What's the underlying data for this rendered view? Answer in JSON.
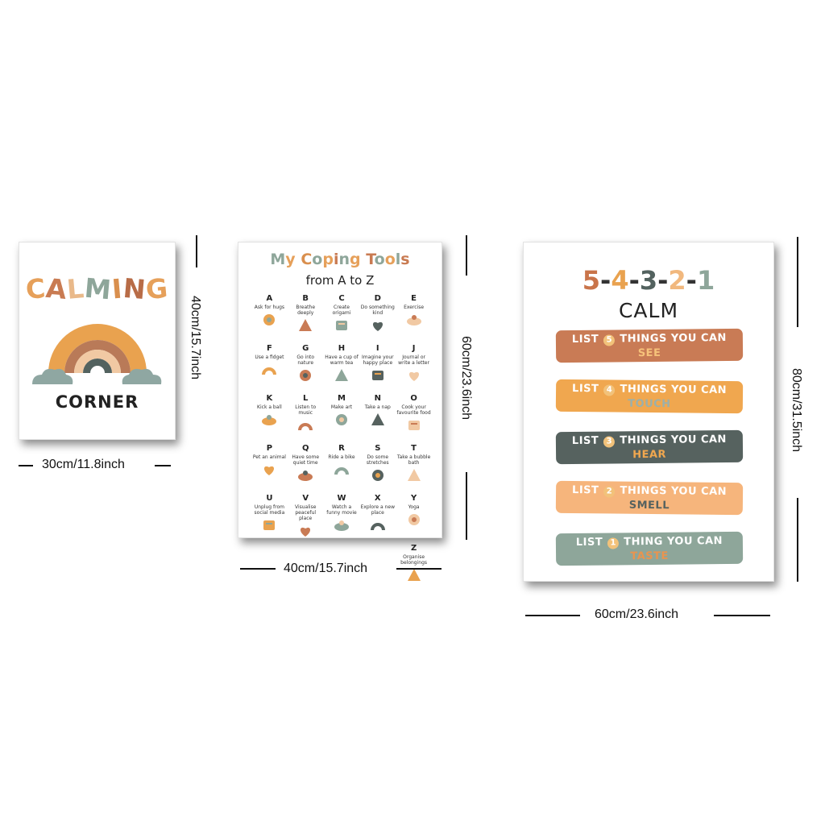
{
  "poster1": {
    "title_letters": [
      {
        "ch": "C",
        "color": "#e6a05a"
      },
      {
        "ch": "A",
        "color": "#c97b52"
      },
      {
        "ch": "L",
        "color": "#e9b98a"
      },
      {
        "ch": "M",
        "color": "#8ea69a"
      },
      {
        "ch": "I",
        "color": "#d98f4e"
      },
      {
        "ch": "N",
        "color": "#b86c47"
      },
      {
        "ch": "G",
        "color": "#e6a05a"
      }
    ],
    "subtitle": "CORNER",
    "size_h": "30cm/11.8inch",
    "size_v": "40cm/15.7inch",
    "colors": {
      "arc1": "#e9a24f",
      "arc2": "#b97a58",
      "arc3": "#f1c9a3",
      "arc4": "#53625f",
      "cloud": "#8fa7a2"
    }
  },
  "poster2": {
    "title_letters": [
      {
        "ch": "M",
        "color": "#8ea69a"
      },
      {
        "ch": "y",
        "color": "#e6a05a"
      },
      {
        "ch": " ",
        "color": "#000"
      },
      {
        "ch": "C",
        "color": "#d98f4e"
      },
      {
        "ch": "o",
        "color": "#8ea69a"
      },
      {
        "ch": "p",
        "color": "#e6a05a"
      },
      {
        "ch": "i",
        "color": "#c97b52"
      },
      {
        "ch": "n",
        "color": "#8ea69a"
      },
      {
        "ch": "g",
        "color": "#e6a05a"
      },
      {
        "ch": " ",
        "color": "#000"
      },
      {
        "ch": "T",
        "color": "#c97b52"
      },
      {
        "ch": "o",
        "color": "#8ea69a"
      },
      {
        "ch": "o",
        "color": "#e6a05a"
      },
      {
        "ch": "l",
        "color": "#8ea69a"
      },
      {
        "ch": "s",
        "color": "#c97b52"
      }
    ],
    "subtitle": "from A to Z",
    "size_h": "40cm/15.7inch",
    "size_v": "60cm/23.6inch",
    "items": [
      {
        "letter": "A",
        "caption": "Ask for hugs",
        "icon": "hand-icon"
      },
      {
        "letter": "B",
        "caption": "Breathe deeply",
        "icon": "lungs-icon"
      },
      {
        "letter": "C",
        "caption": "Create origami",
        "icon": "crane-icon"
      },
      {
        "letter": "D",
        "caption": "Do something kind",
        "icon": "heart-icon"
      },
      {
        "letter": "E",
        "caption": "Exercise",
        "icon": "jump-rope-icon"
      },
      {
        "letter": "F",
        "caption": "Use a fidget",
        "icon": "spinner-icon"
      },
      {
        "letter": "G",
        "caption": "Go into nature",
        "icon": "tree-icon"
      },
      {
        "letter": "H",
        "caption": "Have a cup of warm tea",
        "icon": "cup-icon"
      },
      {
        "letter": "I",
        "caption": "Imagine your happy place",
        "icon": "flower-icon"
      },
      {
        "letter": "J",
        "caption": "Journal or write a letter",
        "icon": "notebook-icon"
      },
      {
        "letter": "K",
        "caption": "Kick a ball",
        "icon": "ball-icon"
      },
      {
        "letter": "L",
        "caption": "Listen to music",
        "icon": "music-icon"
      },
      {
        "letter": "M",
        "caption": "Make art",
        "icon": "paint-icon"
      },
      {
        "letter": "N",
        "caption": "Take a nap",
        "icon": "moon-icon"
      },
      {
        "letter": "O",
        "caption": "Cook your favourite food",
        "icon": "rolling-pin-icon"
      },
      {
        "letter": "P",
        "caption": "Pet an animal",
        "icon": "dog-icon"
      },
      {
        "letter": "Q",
        "caption": "Have some quiet time",
        "icon": "cat-icon"
      },
      {
        "letter": "R",
        "caption": "Ride a bike",
        "icon": "bike-icon"
      },
      {
        "letter": "S",
        "caption": "Do some stretches",
        "icon": "stretch-icon"
      },
      {
        "letter": "T",
        "caption": "Take a bubble bath",
        "icon": "bath-icon"
      },
      {
        "letter": "U",
        "caption": "Unplug from social media",
        "icon": "phone-icon"
      },
      {
        "letter": "V",
        "caption": "Visualise peaceful place",
        "icon": "rainbow-icon"
      },
      {
        "letter": "W",
        "caption": "Watch a funny movie",
        "icon": "popcorn-icon"
      },
      {
        "letter": "X",
        "caption": "Explore a new place",
        "icon": "road-icon"
      },
      {
        "letter": "Y",
        "caption": "Yoga",
        "icon": "yoga-icon"
      },
      {
        "letter": "Z",
        "caption": "Organise belongings",
        "icon": "basket-icon"
      }
    ]
  },
  "poster3": {
    "title_parts": [
      {
        "t": "5",
        "color": "#c9744a"
      },
      {
        "t": "-",
        "color": "#333333"
      },
      {
        "t": "4",
        "color": "#e9a24f"
      },
      {
        "t": "-",
        "color": "#333333"
      },
      {
        "t": "3",
        "color": "#53625f"
      },
      {
        "t": "-",
        "color": "#333333"
      },
      {
        "t": "2",
        "color": "#f1b87e"
      },
      {
        "t": "-",
        "color": "#333333"
      },
      {
        "t": "1",
        "color": "#8ea69a"
      }
    ],
    "calm": "CALM",
    "size_h": "60cm/23.6inch",
    "size_v": "80cm/31.5inch",
    "bands": [
      {
        "pre": "LIST",
        "num": "5",
        "post": "THINGS YOU CAN",
        "sense": "SEE",
        "bg": "#c97b55",
        "sense_color": "#f6c27a"
      },
      {
        "pre": "LIST",
        "num": "4",
        "post": "THINGS YOU CAN",
        "sense": "TOUCH",
        "bg": "#f0a74f",
        "sense_color": "#9bb0aa"
      },
      {
        "pre": "LIST",
        "num": "3",
        "post": "THINGS YOU CAN",
        "sense": "HEAR",
        "bg": "#56625f",
        "sense_color": "#f0a74f"
      },
      {
        "pre": "LIST",
        "num": "2",
        "post": "THINGS YOU CAN",
        "sense": "SMELL",
        "bg": "#f6b57c",
        "sense_color": "#56625f"
      },
      {
        "pre": "LIST",
        "num": "1",
        "post": "THING YOU CAN",
        "sense": "TASTE",
        "bg": "#8ea69a",
        "sense_color": "#e9944f"
      }
    ]
  }
}
